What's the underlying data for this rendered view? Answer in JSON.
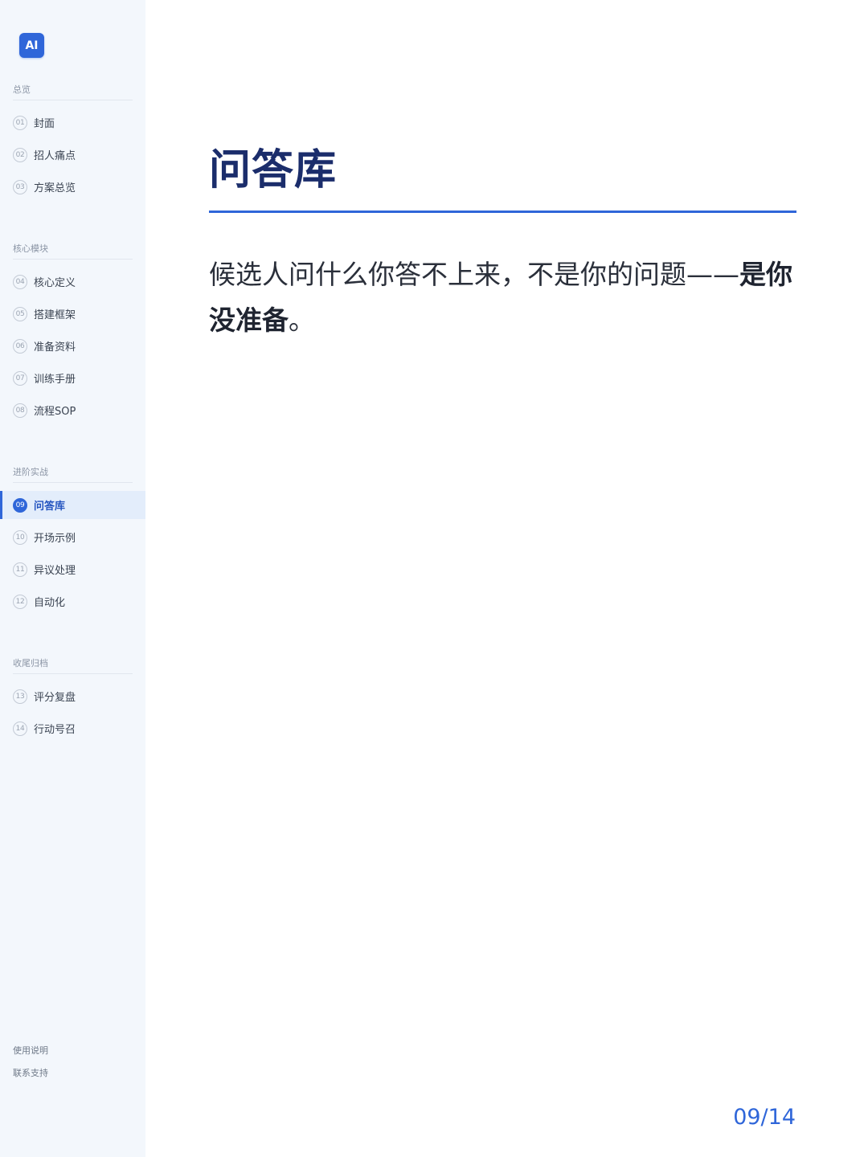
{
  "logo": {
    "text": "AI"
  },
  "sidebar": {
    "sections": [
      {
        "title": "总览",
        "items": [
          {
            "num": "01",
            "label": "封面"
          },
          {
            "num": "02",
            "label": "招人痛点"
          },
          {
            "num": "03",
            "label": "方案总览"
          }
        ]
      },
      {
        "title": "核心模块",
        "items": [
          {
            "num": "04",
            "label": "核心定义"
          },
          {
            "num": "05",
            "label": "搭建框架"
          },
          {
            "num": "06",
            "label": "准备资料"
          },
          {
            "num": "07",
            "label": "训练手册"
          },
          {
            "num": "08",
            "label": "流程SOP"
          }
        ]
      },
      {
        "title": "进阶实战",
        "items": [
          {
            "num": "09",
            "label": "问答库",
            "active": true
          },
          {
            "num": "10",
            "label": "开场示例"
          },
          {
            "num": "11",
            "label": "异议处理"
          },
          {
            "num": "12",
            "label": "自动化"
          }
        ]
      },
      {
        "title": "收尾归档",
        "items": [
          {
            "num": "13",
            "label": "评分复盘"
          },
          {
            "num": "14",
            "label": "行动号召"
          }
        ]
      }
    ],
    "footer": {
      "usage": "使用说明",
      "support": "联系支持"
    }
  },
  "main": {
    "title": "问答库",
    "lead_normal": "候选人问什么你答不上来，不是你的问题——",
    "lead_bold": "是你没准备",
    "lead_end": "。",
    "page_indicator": "09/14"
  },
  "colors": {
    "accent": "#2f66d9",
    "title": "#1b2d6b",
    "sidebar_bg": "#f3f7fc",
    "active_bg": "#e3edfb"
  }
}
